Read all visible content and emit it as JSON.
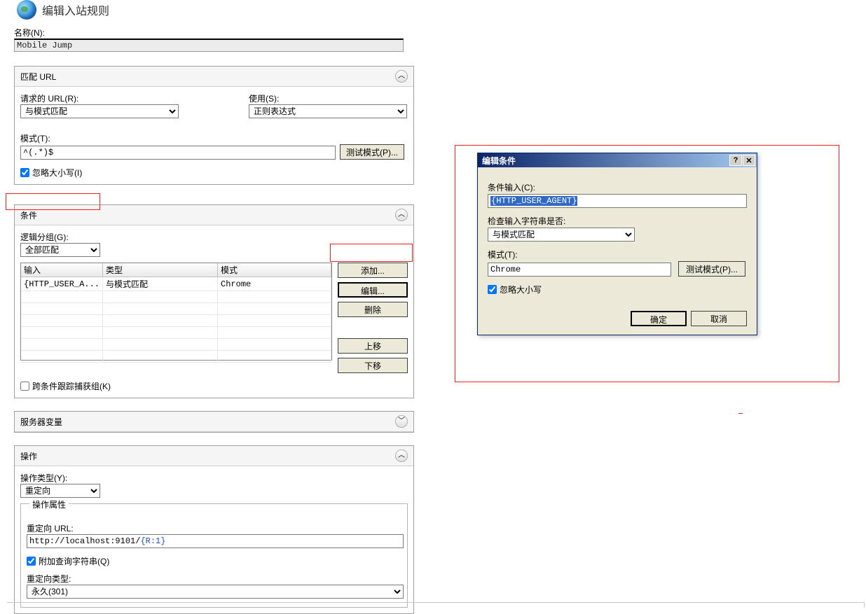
{
  "header": {
    "title": "编辑入站规则"
  },
  "name": {
    "label": "名称(N):",
    "value": "Mobile Jump"
  },
  "match_url": {
    "title": "匹配 URL",
    "requested_url_label": "请求的 URL(R):",
    "requested_url_value": "与模式匹配",
    "using_label": "使用(S):",
    "using_value": "正则表达式",
    "pattern_label": "模式(T):",
    "pattern_value": "^(.*)$",
    "test_button": "测试模式(P)...",
    "ignore_case_label": "忽略大小写(I)",
    "ignore_case_checked": true
  },
  "conditions": {
    "title": "条件",
    "logic_label": "逻辑分组(G):",
    "logic_value": "全部匹配",
    "columns": {
      "input": "输入",
      "type": "类型",
      "pattern": "模式"
    },
    "rows": [
      {
        "input": "{HTTP_USER_A...",
        "type": "与模式匹配",
        "pattern": "Chrome"
      }
    ],
    "buttons": {
      "add": "添加...",
      "edit": "编辑...",
      "delete": "删除",
      "move_up": "上移",
      "move_down": "下移"
    },
    "track_label": "跨条件跟踪捕获组(K)",
    "track_checked": false
  },
  "server_vars": {
    "title": "服务器变量"
  },
  "action": {
    "title": "操作",
    "type_label": "操作类型(Y):",
    "type_value": "重定向",
    "props_legend": "操作属性",
    "redirect_url_label": "重定向 URL:",
    "redirect_url_const": "http://localhost:9101/",
    "redirect_url_var": "{R:1}",
    "append_query_label": "附加查询字符串(Q)",
    "append_query_checked": true,
    "redirect_type_label": "重定向类型:",
    "redirect_type_value": "永久(301)"
  },
  "dialog": {
    "title": "编辑条件",
    "input_label": "条件输入(C):",
    "input_value": "{HTTP_USER_AGENT}",
    "check_label": "检查输入字符串是否:",
    "check_value": "与模式匹配",
    "pattern_label": "模式(T):",
    "pattern_value": "Chrome",
    "test_button": "测试模式(P)...",
    "ignore_case_label": "忽略大小写",
    "ignore_case_checked": true,
    "ok": "确定",
    "cancel": "取消"
  }
}
